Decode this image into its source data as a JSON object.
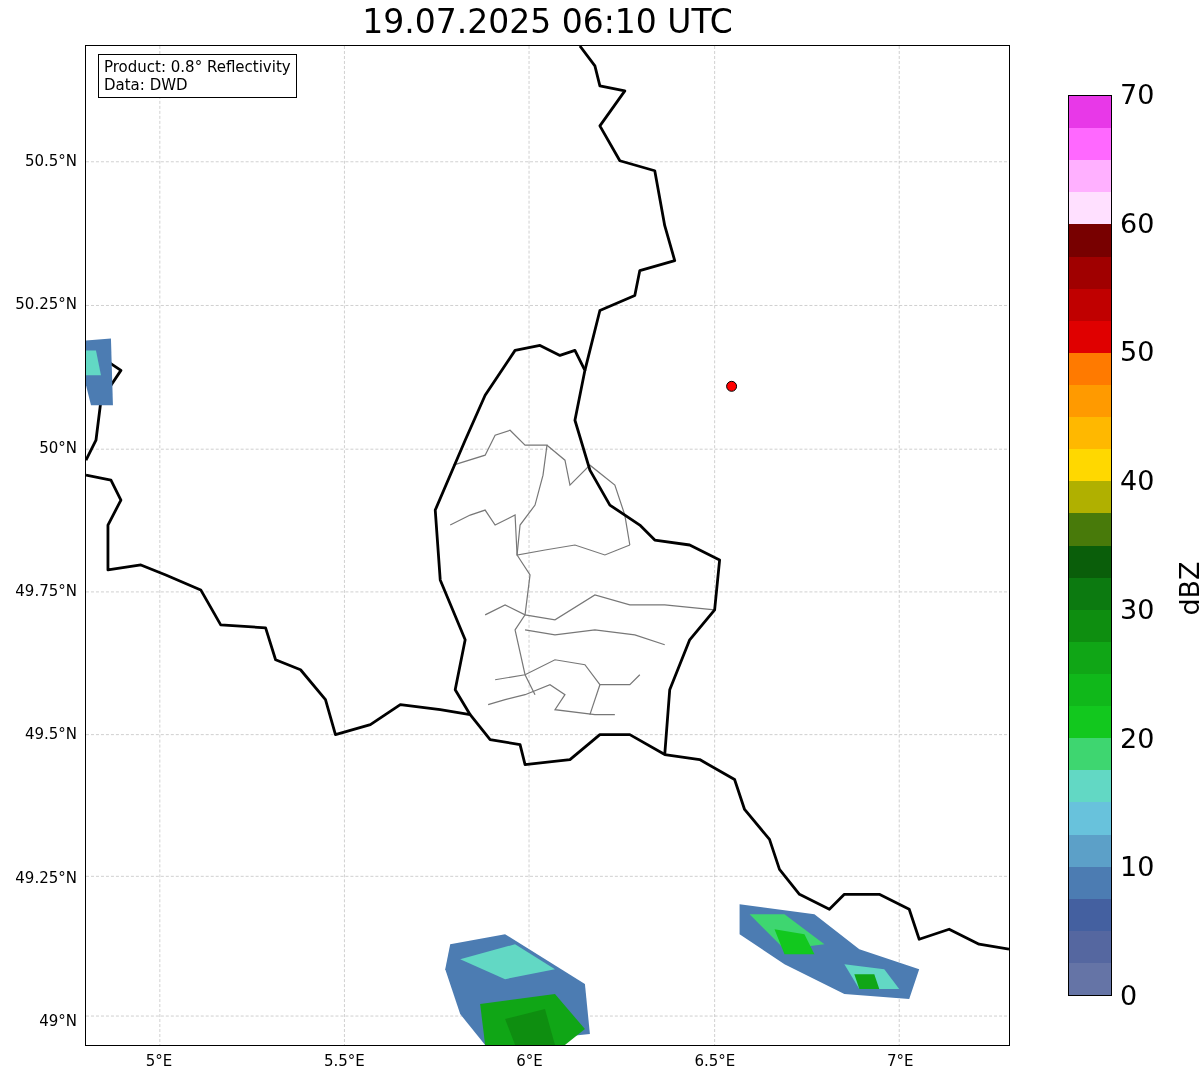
{
  "title": "19.07.2025 06:10 UTC",
  "info_box": [
    "Product: 0.8° Reflectivity",
    "Data: DWD"
  ],
  "y_ticks": [
    "50.5°N",
    "50.25°N",
    "50°N",
    "49.75°N",
    "49.5°N",
    "49.25°N",
    "49°N"
  ],
  "x_ticks": [
    "5°E",
    "5.5°E",
    "6°E",
    "6.5°E",
    "7°E"
  ],
  "colorbar": {
    "label": "dBZ",
    "ticks": [
      "70",
      "60",
      "50",
      "40",
      "30",
      "20",
      "10",
      "0"
    ],
    "bands": [
      {
        "color": "#e838e8"
      },
      {
        "color": "#ff68ff"
      },
      {
        "color": "#ffb0ff"
      },
      {
        "color": "#ffe0ff"
      },
      {
        "color": "#780000"
      },
      {
        "color": "#a00000"
      },
      {
        "color": "#c00000"
      },
      {
        "color": "#e00000"
      },
      {
        "color": "#ff7a00"
      },
      {
        "color": "#ff9a00"
      },
      {
        "color": "#ffb800"
      },
      {
        "color": "#ffd800"
      },
      {
        "color": "#b0b000"
      },
      {
        "color": "#487a0a"
      },
      {
        "color": "#0a5e0a"
      },
      {
        "color": "#0c7a10"
      },
      {
        "color": "#0e8e10"
      },
      {
        "color": "#10a616"
      },
      {
        "color": "#10b81a"
      },
      {
        "color": "#12c81e"
      },
      {
        "color": "#3ed670"
      },
      {
        "color": "#62d8c4"
      },
      {
        "color": "#68c2dc"
      },
      {
        "color": "#5ca0c8"
      },
      {
        "color": "#4c7cb2"
      },
      {
        "color": "#4460a0"
      },
      {
        "color": "#5567a0"
      },
      {
        "color": "#6574a6"
      }
    ]
  }
}
